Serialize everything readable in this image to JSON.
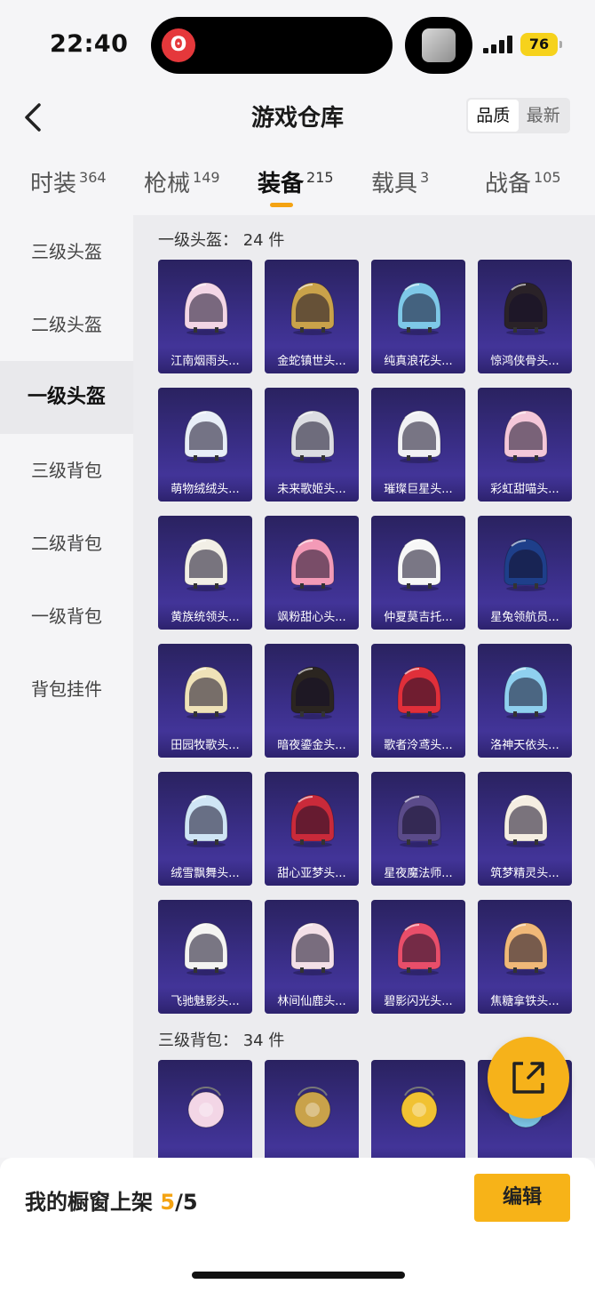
{
  "status": {
    "time": "22:40",
    "battery": "76",
    "app_icon": "netease-cloud-music-icon"
  },
  "header": {
    "title": "游戏仓库",
    "sort_options": [
      "品质",
      "最新"
    ],
    "active_sort": "品质"
  },
  "tabs": [
    {
      "label": "时装",
      "count": "364"
    },
    {
      "label": "枪械",
      "count": "149"
    },
    {
      "label": "装备",
      "count": "215"
    },
    {
      "label": "载具",
      "count": "3"
    },
    {
      "label": "战备",
      "count": "105"
    }
  ],
  "sidebar": {
    "items": [
      "三级头盔",
      "二级头盔",
      "一级头盔",
      "三级背包",
      "二级背包",
      "一级背包",
      "背包挂件"
    ],
    "active": "一级头盔"
  },
  "sections": [
    {
      "title": "一级头盔： 24 件",
      "items": [
        "江南烟雨头...",
        "金蛇镇世头...",
        "纯真浪花头...",
        "惊鸿侠骨头...",
        "萌物绒绒头...",
        "未来歌姬头...",
        "璀璨巨星头...",
        "彩虹甜喵头...",
        "黄族统领头...",
        "飒粉甜心头...",
        "仲夏莫吉托...",
        "星兔领航员...",
        "田园牧歌头...",
        "暗夜鎏金头...",
        "歌者泠鸢头...",
        "洛神天依头...",
        "绒雪飘舞头...",
        "甜心亚梦头...",
        "星夜魔法师...",
        "筑梦精灵头...",
        "飞驰魅影头...",
        "林间仙鹿头...",
        "碧影闪光头...",
        "焦糖拿铁头..."
      ]
    },
    {
      "title": "三级背包： 34 件",
      "items": [
        "",
        "",
        "",
        ""
      ]
    }
  ],
  "colors": {
    "accent": "#f4a312",
    "helmets": [
      "#f3d6e6",
      "#c9a24a",
      "#7ec8e8",
      "#2a2228",
      "#e8eef7",
      "#dcdde2",
      "#f1f1f4",
      "#f4c7d9",
      "#f2efe6",
      "#f39ab7",
      "#f7f7f7",
      "#1e3f8a",
      "#efe2b8",
      "#2b2520",
      "#e02f3a",
      "#8fd0ef",
      "#cfe5f5",
      "#c92a3a",
      "#5b4b8a",
      "#f5eee2",
      "#f4f4f2",
      "#f3dfe7",
      "#e84e6a",
      "#f0b878"
    ],
    "bag_items": [
      "#f3d6e6",
      "#c9a24a",
      "#f1c232",
      "#7ec8e8"
    ]
  },
  "footer": {
    "shelf_label": "我的橱窗上架",
    "shelf_current": "5",
    "shelf_total": "/5",
    "edit_label": "编辑"
  }
}
